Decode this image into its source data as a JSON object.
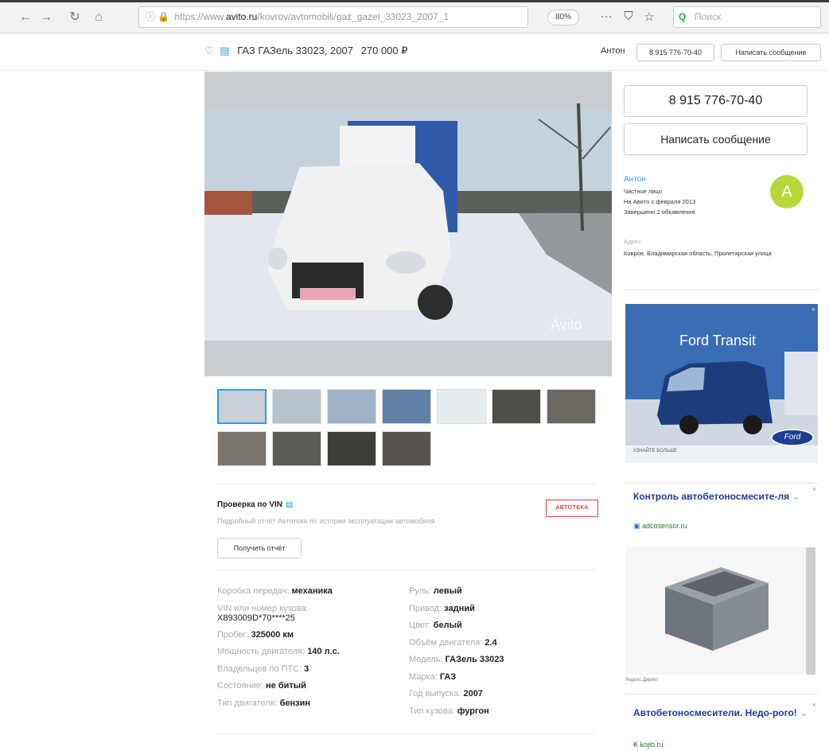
{
  "browser": {
    "url_prefix": "https://www.",
    "url_domain": "avito.ru",
    "url_path": "/kovrov/avtomobili/gaz_gazel_33023_2007_1",
    "zoom": "80%",
    "search_placeholder": "Поиск"
  },
  "sticky": {
    "title": "ГАЗ ГАЗель 33023, 2007",
    "price": "270 000 ₽",
    "seller": "Антон",
    "phone_label": "8 915 776-70-40",
    "message_label": "Написать сообщение"
  },
  "photo": {
    "watermark": "Avito"
  },
  "vin": {
    "title": "Проверка по VIN",
    "description": "Подробный отчёт Автотеки по истории эксплуатации автомобиля",
    "badge": "АВТОТЕКА",
    "button_label": "Получить отчёт"
  },
  "params_left": [
    {
      "key": "Коробка передач: ",
      "value": "механика"
    },
    {
      "key": "VIN или номер кузова:",
      "value": "X893009D*70****25"
    },
    {
      "key": "Пробег: ",
      "value": "325000 км"
    },
    {
      "key": "Мощность двигателя: ",
      "value": "140 л.с."
    },
    {
      "key": "Владельцев по ПТС: ",
      "value": "3"
    },
    {
      "key": "Состояние: ",
      "value": "не битый"
    },
    {
      "key": "Тип двигателя: ",
      "value": "бензин"
    }
  ],
  "params_right": [
    {
      "key": "Руль: ",
      "value": "левый"
    },
    {
      "key": "Привод: ",
      "value": "задний"
    },
    {
      "key": "Цвет: ",
      "value": "белый"
    },
    {
      "key": "Объём двигателя: ",
      "value": "2.4"
    },
    {
      "key": "Модель: ",
      "value": "ГАЗель 33023"
    },
    {
      "key": "Марка: ",
      "value": "ГАЗ"
    },
    {
      "key": "Год выпуска: ",
      "value": "2007"
    },
    {
      "key": "Тип кузова: ",
      "value": "фургон"
    }
  ],
  "sidebar": {
    "phone": "8 915 776-70-40",
    "message": "Написать сообщение",
    "seller_name": "Антон",
    "seller_type": "Частное лицо",
    "since": "На Авито с февраля 2013",
    "completed": "Завершено 2 объявления",
    "avatar_letter": "A",
    "address_label": "Адрес",
    "address": "Ковров, Владимирская область, Пролетарская улица"
  },
  "ads": {
    "ford_title": "Ford Transit",
    "ford_caption": "УЗНАЙТЕ БОЛЬШЕ",
    "ford_logo": "Ford",
    "ad2_title": "Контроль автобетоносмесите-ля",
    "ad2_domain": "adcosensor.ru",
    "ad_small": "Яндекс.Директ",
    "ad3_title": "Автобетоносмесители. Недо-рого!",
    "ad3_domain": "kojib.ru",
    "close": "×"
  },
  "colors": {
    "link": "#2d9ef5",
    "ad_title": "#1a3c9e",
    "avatar": "#b8d83a",
    "autoteka": "#e43b3b"
  }
}
